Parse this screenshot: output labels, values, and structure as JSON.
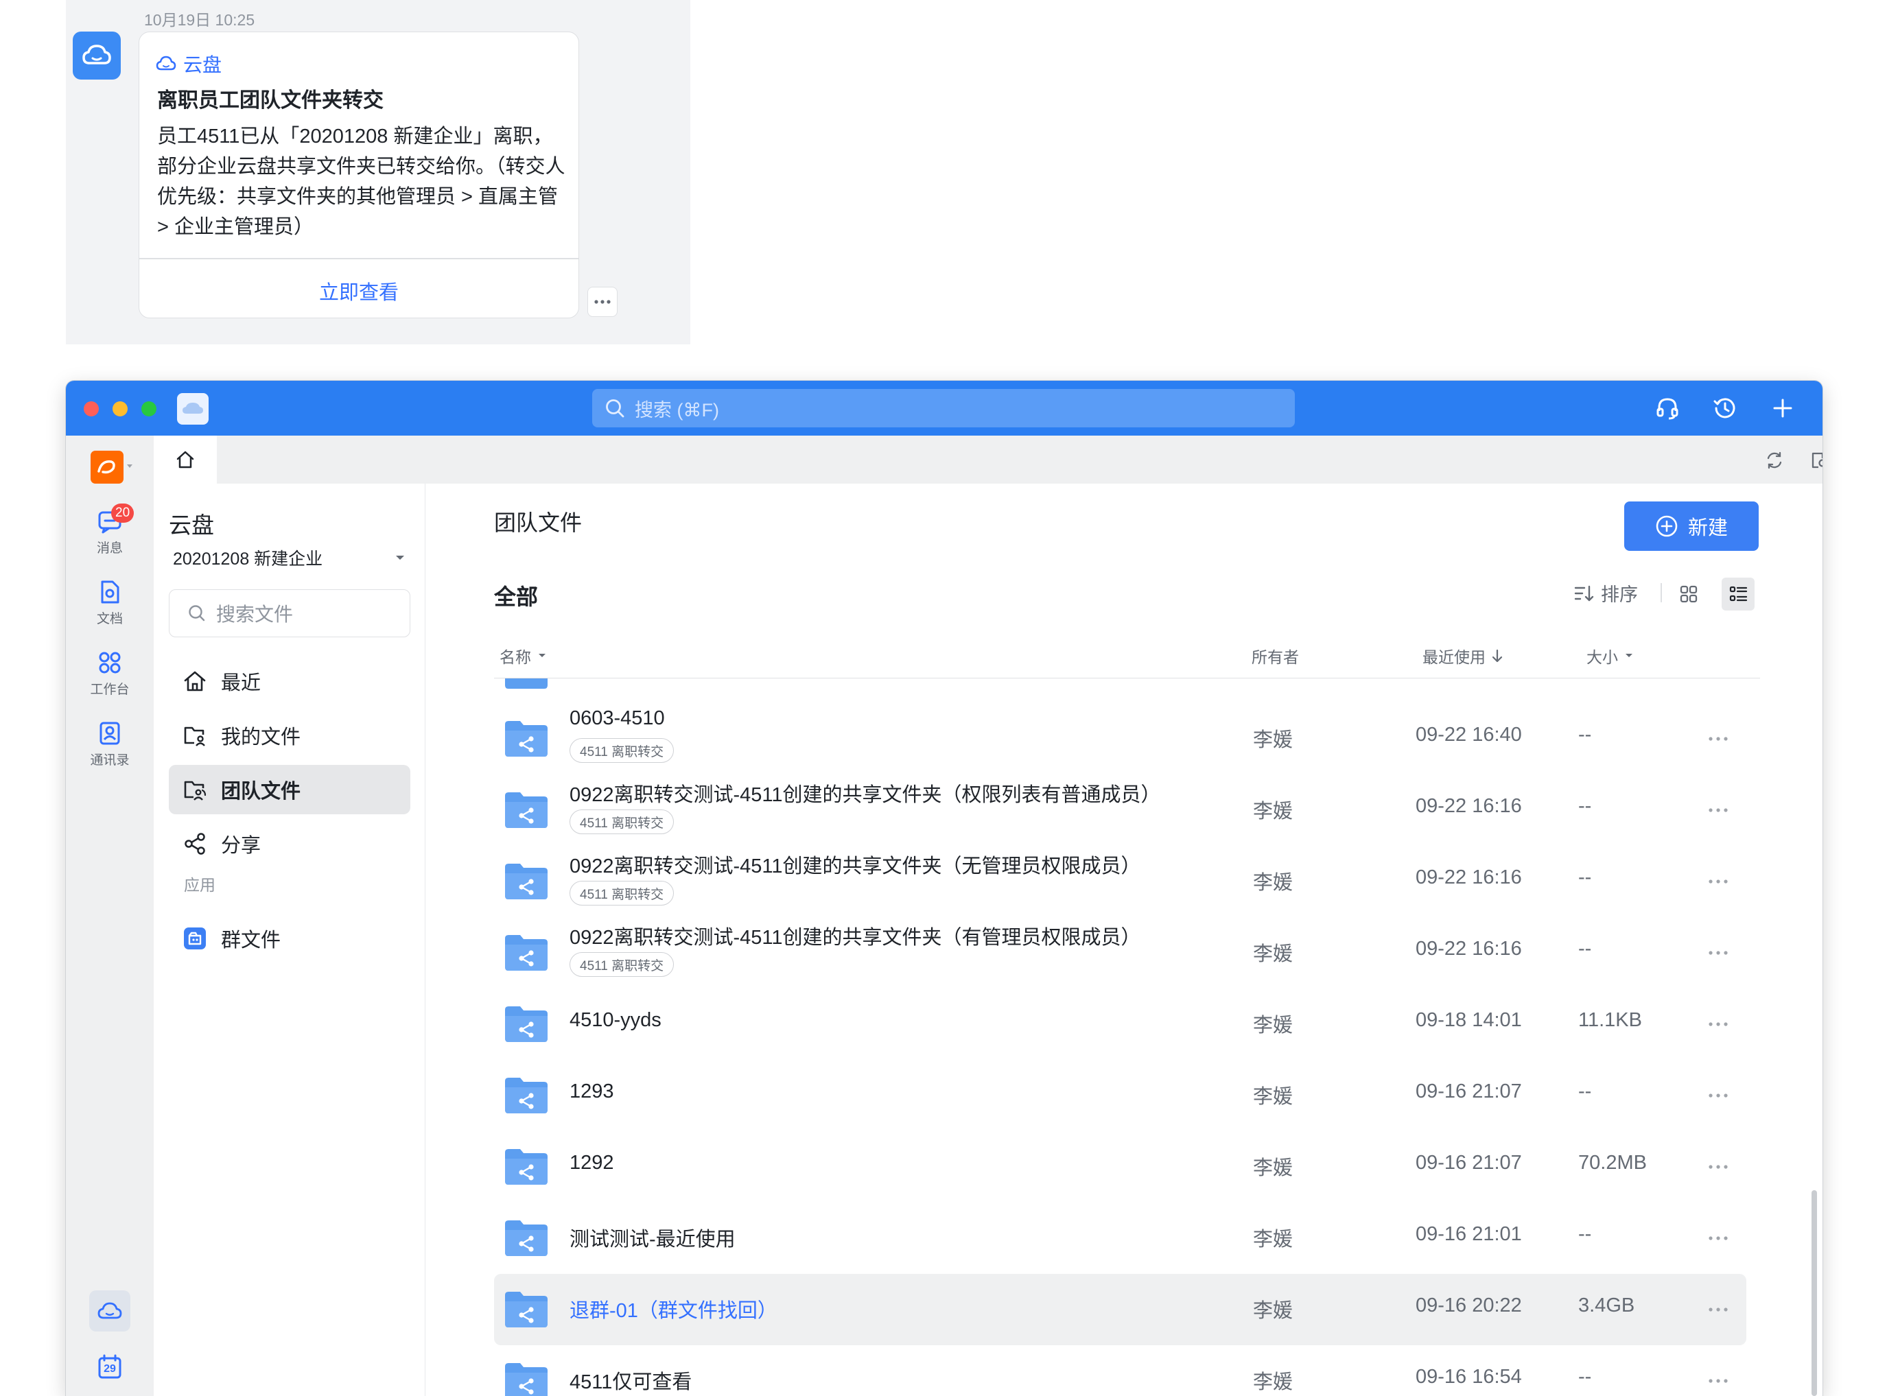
{
  "notification": {
    "time": "10月19日 10:25",
    "app_name": "云盘",
    "title": "离职员工团队文件夹转交",
    "body": "员工4511已从「20201208 新建企业」离职，部分企业云盘共享文件夹已转交给你。（转交人优先级：共享文件夹的其他管理员 > 直属主管 > 企业主管理员）",
    "action": "立即查看"
  },
  "window": {
    "search_placeholder": "搜索 (⌘F)"
  },
  "rail": {
    "messages": {
      "label": "消息",
      "badge": "20"
    },
    "docs": {
      "label": "文档"
    },
    "workbench": {
      "label": "工作台"
    },
    "contacts": {
      "label": "通讯录"
    },
    "calendar_day": "29"
  },
  "sidebar": {
    "title": "云盘",
    "org": "20201208 新建企业",
    "search_placeholder": "搜索文件",
    "nav": {
      "recent": "最近",
      "my_files": "我的文件",
      "team_files": "团队文件",
      "share": "分享"
    },
    "apps_section": "应用",
    "group_files": "群文件"
  },
  "main": {
    "page_title": "团队文件",
    "new_button": "新建",
    "section_title": "全部",
    "sort_label": "排序",
    "columns": {
      "name": "名称",
      "owner": "所有者",
      "recent": "最近使用",
      "size": "大小"
    },
    "rows": [
      {
        "name": "0603-4510",
        "tag": "4511 离职转交",
        "owner": "李媛",
        "recent": "09-22 16:40",
        "size": "--"
      },
      {
        "name": "0922离职转交测试-4511创建的共享文件夹（权限列表有普通成员）",
        "tag": "4511 离职转交",
        "owner": "李媛",
        "recent": "09-22 16:16",
        "size": "--"
      },
      {
        "name": "0922离职转交测试-4511创建的共享文件夹（无管理员权限成员）",
        "tag": "4511 离职转交",
        "owner": "李媛",
        "recent": "09-22 16:16",
        "size": "--"
      },
      {
        "name": "0922离职转交测试-4511创建的共享文件夹（有管理员权限成员）",
        "tag": "4511 离职转交",
        "owner": "李媛",
        "recent": "09-22 16:16",
        "size": "--"
      },
      {
        "name": "4510-yyds",
        "tag": "",
        "owner": "李媛",
        "recent": "09-18 14:01",
        "size": "11.1KB"
      },
      {
        "name": "1293",
        "tag": "",
        "owner": "李媛",
        "recent": "09-16 21:07",
        "size": "--"
      },
      {
        "name": "1292",
        "tag": "",
        "owner": "李媛",
        "recent": "09-16 21:07",
        "size": "70.2MB"
      },
      {
        "name": "测试测试-最近使用",
        "tag": "",
        "owner": "李媛",
        "recent": "09-16 21:01",
        "size": "--"
      },
      {
        "name": "退群-01（群文件找回）",
        "tag": "",
        "owner": "李媛",
        "recent": "09-16 20:22",
        "size": "3.4GB"
      },
      {
        "name": "4511仅可查看",
        "tag": "",
        "owner": "李媛",
        "recent": "09-16 16:54",
        "size": "--"
      }
    ]
  },
  "colors": {
    "accent": "#3370ff",
    "titlebar": "#2b7ef2",
    "folder": "#5c9ef0",
    "badge": "#f54a45"
  }
}
